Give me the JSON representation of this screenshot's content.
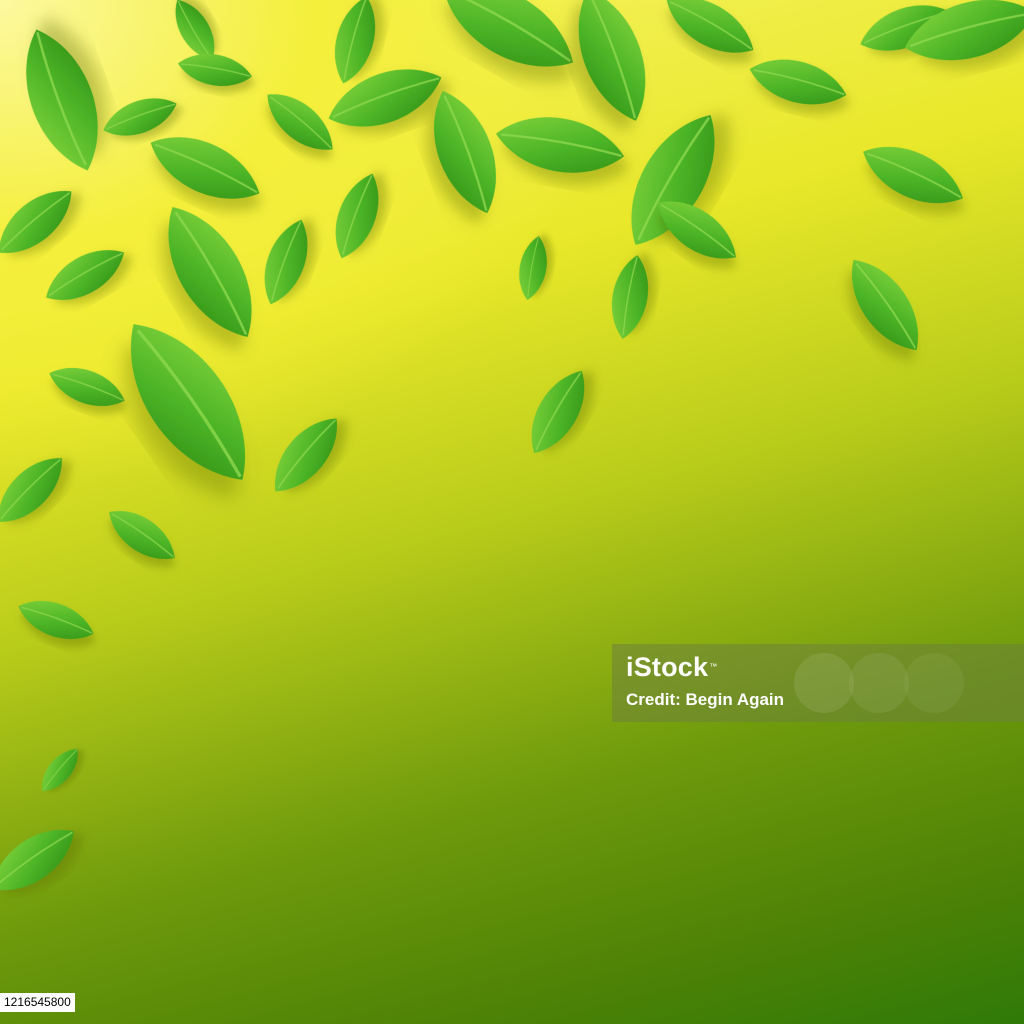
{
  "scene": {
    "description_colors": {
      "leaf_light": "#7fd33a",
      "leaf_mid": "#46ad22",
      "leaf_dark": "#2e8a16",
      "background_top": "#f8f46a",
      "background_bottom": "#2f7a08"
    }
  },
  "watermark": {
    "logo": "iStock",
    "logo_mark": "™",
    "credit": "Credit: Begin Again"
  },
  "image_id": {
    "text": "1216545800"
  }
}
